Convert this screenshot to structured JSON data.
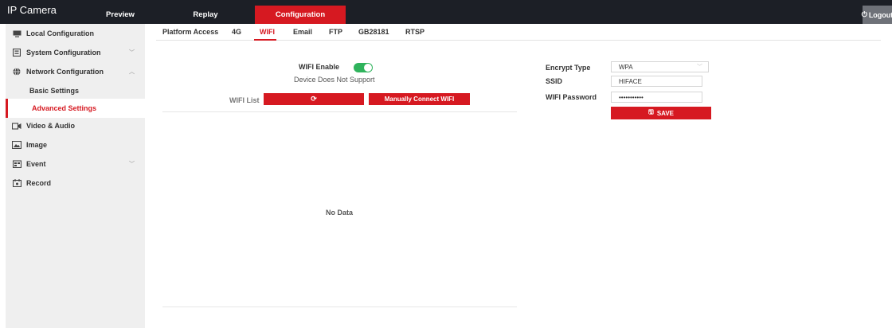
{
  "topbar": {
    "title": "IP Camera",
    "tabs": [
      "Preview",
      "Replay",
      "Configuration"
    ],
    "logout": "Logout"
  },
  "sidebar": {
    "items": [
      {
        "label": "Local Configuration",
        "icon": "monitor-icon"
      },
      {
        "label": "System Configuration",
        "icon": "system-icon"
      },
      {
        "label": "Network Configuration",
        "icon": "network-icon"
      },
      {
        "label": "Basic Settings"
      },
      {
        "label": "Advanced Settings"
      },
      {
        "label": "Video & Audio",
        "icon": "video-icon"
      },
      {
        "label": "Image",
        "icon": "image-icon"
      },
      {
        "label": "Event",
        "icon": "event-icon"
      },
      {
        "label": "Record",
        "icon": "record-icon"
      }
    ]
  },
  "subtabs": [
    "Platform Access",
    "4G",
    "WIFI",
    "Email",
    "FTP",
    "GB28181",
    "RTSP"
  ],
  "wifi": {
    "enable_label": "WIFI Enable",
    "enabled": true,
    "status": "Device Does Not Support",
    "list_label": "WIFI List",
    "refresh_icon": "refresh-icon",
    "manual_connect": "Manually Connect WIFI",
    "empty": "No Data"
  },
  "form": {
    "encrypt_label": "Encrypt Type",
    "encrypt_value": "WPA",
    "ssid_label": "SSID",
    "ssid_value": "HIFACE",
    "password_label": "WIFI Password",
    "password_value": "•••••••••••",
    "save_label": "SAVE"
  },
  "colors": {
    "accent": "#d61921",
    "topbar": "#1c1f26",
    "toggle_on": "#2fb35c"
  }
}
